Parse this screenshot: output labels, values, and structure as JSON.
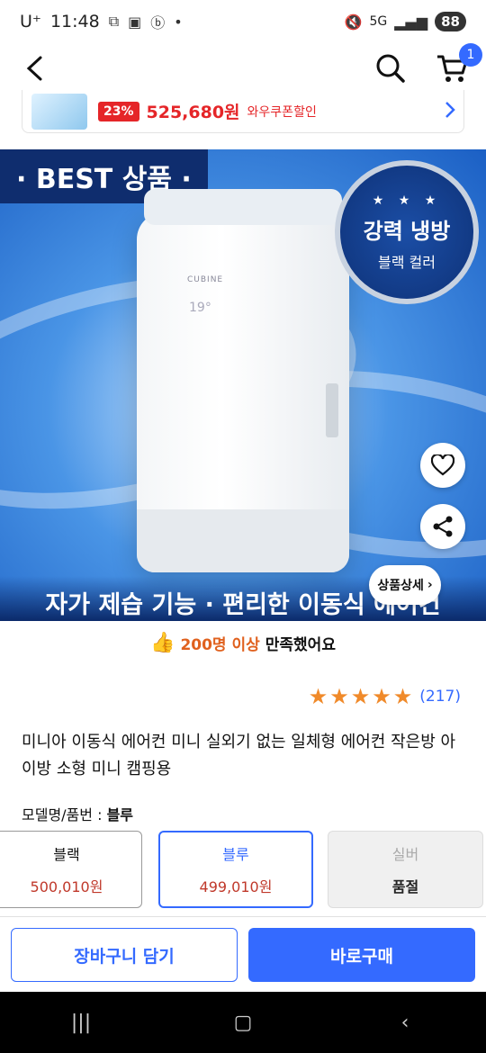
{
  "status_bar": {
    "carrier": "U⁺",
    "time": "11:48",
    "battery": "88",
    "network": "5G"
  },
  "nav": {
    "cart_count": "1"
  },
  "promo": {
    "discount": "23%",
    "price": "525,680원",
    "coupon": "와우쿠폰할인"
  },
  "hero": {
    "best_tag": "· BEST 상품 ·",
    "medallion_main": "강력 냉방",
    "medallion_sub": "블랙 컬러",
    "stars": "★ ★ ★",
    "brand": "CUBINE",
    "display": "19°",
    "caption": "자가 제습 기능 · 편리한 이동식 에어컨",
    "detail_label": "상품상세"
  },
  "satisfaction": {
    "count": "200명 이상",
    "text": "만족했어요"
  },
  "rating": {
    "stars": 5,
    "review_count": "(217)"
  },
  "product": {
    "title": "미니아 이동식 에어컨 미니 실외기 없는 일체형 에어컨 작은방 아이방 소형 미니 캠핑용",
    "model_label": "모델명/품번 :",
    "model_value": "블루"
  },
  "options": [
    {
      "name": "블랙",
      "price": "500,010원",
      "state": "normal"
    },
    {
      "name": "블루",
      "price": "499,010원",
      "state": "selected"
    },
    {
      "name": "실버",
      "price": "품절",
      "state": "soldout"
    }
  ],
  "actions": {
    "cart": "장바구니 담기",
    "buy": "바로구매"
  },
  "colors": {
    "accent": "#346aff",
    "sale_red": "#e52528",
    "star_orange": "#f08a2a"
  }
}
